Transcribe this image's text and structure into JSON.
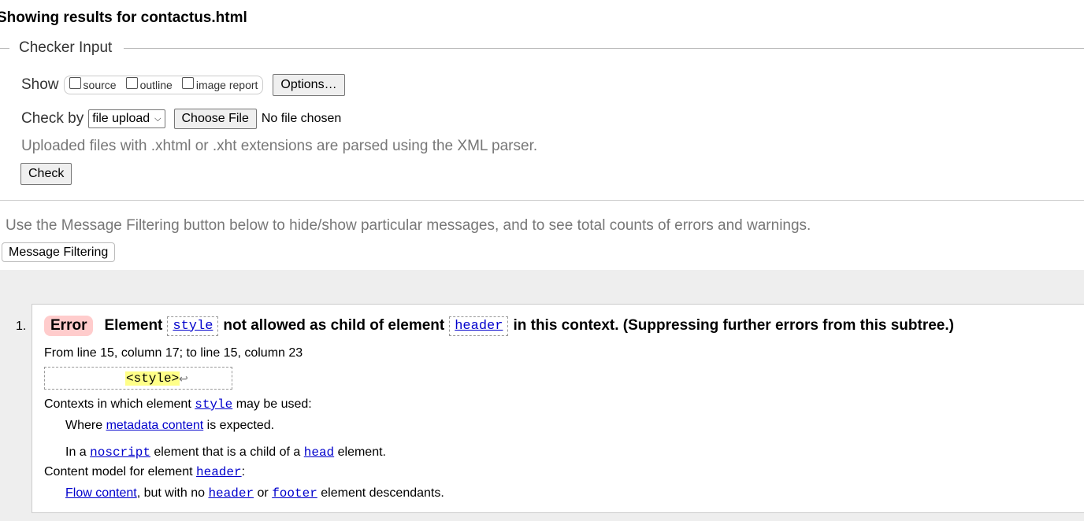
{
  "heading": "Showing results for contactus.html",
  "checker_input": {
    "legend": "Checker Input",
    "show_label": "Show",
    "checkboxes": [
      "source",
      "outline",
      "image report"
    ],
    "options_button": "Options…",
    "check_by_label": "Check by",
    "check_by_value": "file upload",
    "choose_file_button": "Choose File",
    "no_file_text": "No file chosen",
    "note": "Uploaded files with .xhtml or .xht extensions are parsed using the XML parser.",
    "check_button": "Check"
  },
  "filter_note": "Use the Message Filtering button below to hide/show particular messages, and to see total counts of errors and warnings.",
  "message_filtering_button": "Message Filtering",
  "messages": [
    {
      "number": "1.",
      "type": "Error",
      "text_1": "Element",
      "code_1": "style",
      "text_2": "not allowed as child of element",
      "code_2": "header",
      "text_3": "in this context. (Suppressing further errors from this subtree.)",
      "location": "From line 15, column 17; to line 15, column 23",
      "extract": "<style>",
      "extract_cr": "↩",
      "contexts_prefix": "Contexts in which element",
      "contexts_code": "style",
      "contexts_suffix": "may be used:",
      "where_prefix": "Where",
      "where_link": "metadata content",
      "where_suffix": "is expected.",
      "in_a": "In a",
      "noscript": "noscript",
      "child_of": "element that is a child of a",
      "head": "head",
      "element_end": "element.",
      "model_prefix": "Content model for element",
      "model_code": "header",
      "colon": ":",
      "flow_link": "Flow content",
      "flow_mid": ", but with no",
      "flow_header": "header",
      "flow_or": "or",
      "flow_footer": "footer",
      "flow_end": "element descendants."
    }
  ]
}
